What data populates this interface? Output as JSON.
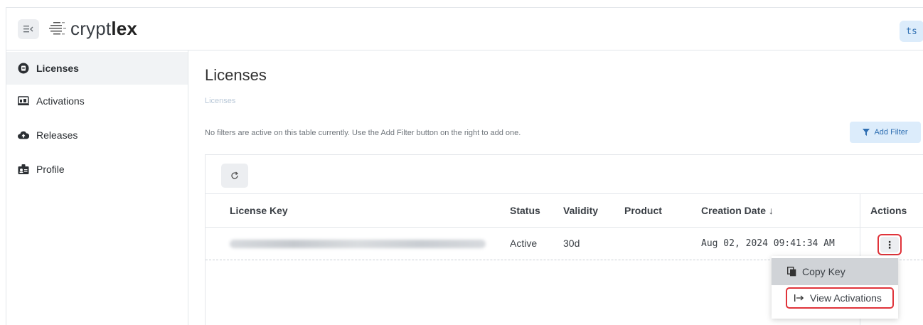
{
  "header": {
    "logo_light": "crypt",
    "logo_bold": "lex",
    "avatar": "ts"
  },
  "sidebar": {
    "items": [
      {
        "label": "Licenses",
        "icon": "license-icon",
        "active": true
      },
      {
        "label": "Activations",
        "icon": "activations-icon",
        "active": false
      },
      {
        "label": "Releases",
        "icon": "cloud-upload-icon",
        "active": false
      },
      {
        "label": "Profile",
        "icon": "id-badge-icon",
        "active": false
      }
    ]
  },
  "main": {
    "title": "Licenses",
    "breadcrumb": "Licenses",
    "filter_note": "No filters are active on this table currently. Use the Add Filter button on the right to add one.",
    "add_filter_label": "Add Filter"
  },
  "table": {
    "columns": [
      "License Key",
      "Status",
      "Validity",
      "Product",
      "Creation Date ↓",
      "Actions"
    ],
    "rows": [
      {
        "license_key": "",
        "status": "Active",
        "validity": "30d",
        "product": "",
        "creation_date": "Aug 02, 2024 09:41:34 AM"
      }
    ],
    "kebab_label": "⋮"
  },
  "menu": {
    "items": [
      {
        "label": "Copy Key",
        "icon": "copy-icon"
      },
      {
        "label": "View Activations",
        "icon": "arrow-right-to-bar-icon"
      }
    ]
  },
  "colors": {
    "highlight": "#e0333a",
    "accent": "#2f6fb2",
    "accent_bg": "#dcecfb"
  }
}
